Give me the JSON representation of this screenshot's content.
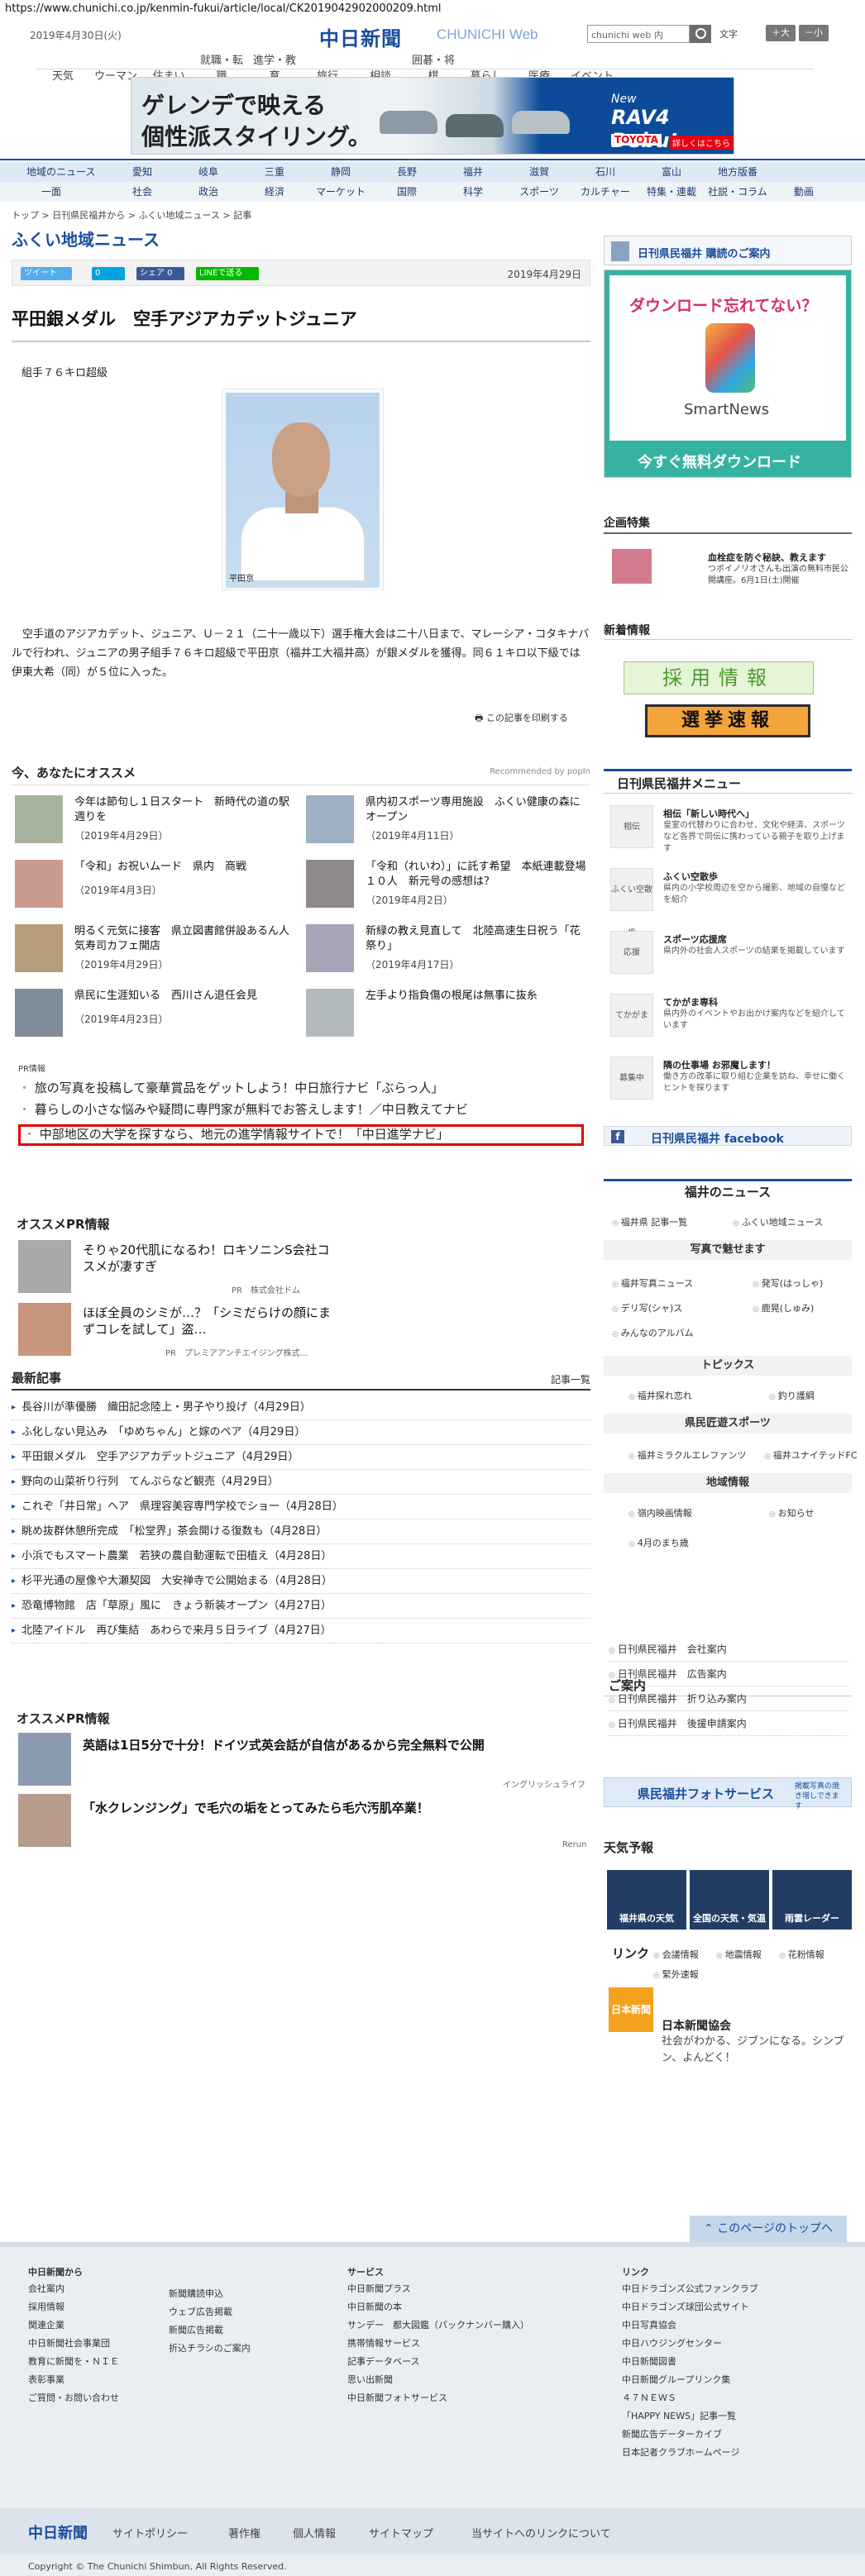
{
  "url": "https://www.chunichi.co.jp/kenmin-fukui/article/local/CK2019042902000209.html",
  "header": {
    "date": "2019年4月30日(火)",
    "logo": "中日新聞",
    "logo_web": "CHUNICHI Web",
    "search_placeholder": "chunichi web 内",
    "fontsize_label": "文字",
    "font_big": "＋大",
    "font_small": "－小"
  },
  "topnav": [
    "天気",
    "ウーマン",
    "住まい",
    "就職・転職",
    "進学・教育",
    "旅行",
    "相談",
    "囲碁・将棋",
    "暮らし",
    "医療",
    "イベント"
  ],
  "ad_banner": {
    "line1": "ゲレンデで映える",
    "line2": "個性派スタイリング。",
    "new": "New",
    "model": "RAV4 Debut",
    "brand": "TOYOTA",
    "detail": "詳しくはこちら"
  },
  "catnav_row1": [
    "地域のニュース",
    "愛知",
    "岐阜",
    "三重",
    "静岡",
    "長野",
    "福井",
    "滋賀",
    "石川",
    "富山",
    "地方版番"
  ],
  "catnav_row2": [
    "一面",
    "社会",
    "政治",
    "経済",
    "マーケット",
    "国際",
    "科学",
    "スポーツ",
    "カルチャー",
    "特集・連載",
    "社説・コラム",
    "動画"
  ],
  "breadcrumb": "トップ > 日刊県民福井から > ふくい地域ニュース > 記事",
  "section_title": "ふくい地域ニュース",
  "share": {
    "tweet": "ツイート",
    "b": "0",
    "share": "シェア 0",
    "line": "LINEで送る",
    "date": "2019年4月29日"
  },
  "article": {
    "headline": "平田銀メダル　空手アジアカデットジュニア",
    "caption_top": "組手７６キロ超級",
    "photo_caption": "平田京",
    "body": "空手道のアジアカデット、ジュニア、Ｕ－２１（二十一歳以下）選手権大会は二十八日まで、マレーシア・コタキナバルで行われ、ジュニアの男子組手７６キロ超級で平田京（福井工大福井高）が銀メダルを獲得。同６１キロ以下級では伊東大希（同）が５位に入った。",
    "print": "この記事を印刷する"
  },
  "reco": {
    "title": "今、あなたにオススメ",
    "right": "Recommended by popIn",
    "items": [
      {
        "title": "今年は節句し１日スタート　新時代の道の駅週りを",
        "date": "（2019年4月29日）"
      },
      {
        "title": "県内初スポーツ専用施設　ふくい健康の森にオープン",
        "date": "（2019年4月11日）"
      },
      {
        "title": "「令和」お祝いムード　県内　商戦",
        "date": "（2019年4月3日）"
      },
      {
        "title": "「令和（れいわ）」に託す希望　本紙連載登場１０人　新元号の感想は？",
        "date": "（2019年4月2日）"
      },
      {
        "title": "明るく元気に接客　県立図書館併設あるん人気寿司カフェ開店",
        "date": "（2019年4月29日）"
      },
      {
        "title": "新緑の教え見直して　北陸高速生日祝う「花祭り」",
        "date": "（2019年4月17日）"
      },
      {
        "title": "県民に生涯知いる　西川さん退任会見",
        "date": "（2019年4月23日）"
      },
      {
        "title": "左手より指負傷の根尾は無事に抜糸",
        "date": ""
      }
    ]
  },
  "pr": {
    "label": "PR情報",
    "lines": [
      "旅の写真を投稿して豪華賞品をゲットしよう！中日旅行ナビ「ぶらっ人」",
      "暮らしの小さな悩みや疑問に専門家が無料でお答えします！／中日教えてナビ",
      "中部地区の大学を探すなら、地元の進学情報サイトで！「中日進学ナビ」"
    ]
  },
  "oss_pr": {
    "title": "オススメPR情報",
    "items": [
      {
        "title": "そりゃ20代肌になるわ！ロキソニンS会社コスメが凄すぎ",
        "src": "PR　株式会社ドム"
      },
      {
        "title": "ほぼ全員のシミが…？「シミだらけの顔にまずコレを試して」盗…",
        "src": "PR　プレミアアンチエイジング株式…"
      }
    ]
  },
  "latest": {
    "title": "最新記事",
    "more": "記事一覧",
    "items": [
      "長谷川が準優勝　織田記念陸上・男子やり投げ（4月29日）",
      "ふ化しない見込み　「ゆめちゃん」と嫁のペア（4月29日）",
      "平田銀メダル　空手アジアカデットジュニア（4月29日）",
      "野向の山菜祈り行列　てんぷらなど観売（4月29日）",
      "これぞ「井日常」ヘア　県理容美容専門学校でショー（4月28日）",
      "眺め抜群休憩所完成　「松堂界」茶会開ける復数も（4月28日）",
      "小浜でもスマート農業　若狭の農自動運転で田植え（4月28日）",
      "杉平光通の屋像や大瀬契図　大安禅寺で公開始まる（4月28日）",
      "恐竜博物館　店「草原」風に　きょう新装オープン（4月27日）",
      "北陸アイドル　再び集結　あわらで来月５日ライブ（4月27日）"
    ]
  },
  "oss_pr2": {
    "title": "オススメPR情報",
    "items": [
      {
        "title": "英語は1日5分で十分！ドイツ式英会話が自信があるから完全無料で公開",
        "src": "イングリッシュライフ"
      },
      {
        "title": "「水クレンジング」で毛穴の垢をとってみたら毛穴汚肌卒業！",
        "src": "Rerun"
      }
    ]
  },
  "sidebar": {
    "subscribe": "日刊県民福井 購読のご案内",
    "ad": {
      "t1": "ダウンロード忘れてない？",
      "t2": "SmartNews",
      "t3": "今すぐ無料ダウンロード"
    },
    "kikaku_title": "企画特集",
    "kikaku_item": {
      "title": "血栓症を防ぐ秘訣、教えます",
      "desc": "つボイノリオさんも出演の無料市民公開講座。6月1日(土)開催"
    },
    "news_title": "新着情報",
    "banner1": "採用情報",
    "banner2": "選挙速報",
    "menu_title": "日刊県民福井メニュー",
    "menu": [
      {
        "icon": "相伝",
        "title": "相伝「新しい時代へ」",
        "desc": "皇室の代替わりに合わせ、文化や経済、スポーツなど各界で同伝に携わっている親子を取り上げます"
      },
      {
        "icon": "ふくい空散歩",
        "title": "ふくい空散歩",
        "desc": "県内の小学校周辺を空から撮影、地域の自慢などを紹介"
      },
      {
        "icon": "応援",
        "title": "スポーツ応援席",
        "desc": "県内外の社会人スポーツの結果を掲載しています"
      },
      {
        "icon": "てかがま",
        "title": "てかがま専科",
        "desc": "県内外のイベントやお出かけ案内などを紹介しています"
      },
      {
        "icon": "募集中",
        "title": "隣の仕事場 お邪魔します！",
        "desc": "働き方の改革に取り組む企業を訪ね、幸せに働くヒントを探ります"
      }
    ],
    "facebook": "日刊県民福井 facebook",
    "fukui_news": "福井のニュース",
    "fukui_links": [
      "福井県 記事一覧",
      "ふくい地域ニュース"
    ],
    "photo_title": "写真で魅せます",
    "photo_links": [
      "福井写真ニュース",
      "発写(はっしゃ)",
      "デリ写(シャ)ス",
      "鹿晃(しゅみ)",
      "みんなのアルバム"
    ],
    "topics_title": "トピックス",
    "topics_links": [
      "福井探れ恋れ",
      "釣り護綱"
    ],
    "sports_title": "県民匠遊スポーツ",
    "sports_links": [
      "福井ミラクルエレファンツ",
      "福井ユナイテッドFC"
    ],
    "region_title": "地域情報",
    "region_links": [
      "嶺内映画情報",
      "お知らせ",
      "4月のまち歳"
    ],
    "goannai_title": "ご案内",
    "goannai": [
      "日刊県民福井　会社案内",
      "日刊県民福井　広告案内",
      "日刊県民福井　折り込み案内",
      "日刊県民福井　後援申請案内"
    ],
    "photo_service": "県民福井フォトサービス",
    "photo_service_sub": "掲載写真の焼き増しできます",
    "weather_title": "天気予報",
    "weather": [
      "福井県の天気",
      "全国の天気・気温",
      "雨雲レーダー"
    ],
    "link_title": "リンク",
    "link_items": [
      "会議情報",
      "地震情報",
      "花粉情報",
      "緊外速報"
    ],
    "nbook_icon": "日本新聞",
    "nbook_title": "日本新聞協会",
    "nbook_desc": "社会がわかる、ジブンになる。シンブン、よんどく！"
  },
  "pagetop": "このページのトップへ",
  "footer": {
    "col1_title": "中日新聞から",
    "col1": [
      "会社案内",
      "採用情報",
      "関連企業",
      "中日新聞社会事業団",
      "教育に新聞を・ＮＩＥ",
      "表彰事業",
      "ご質問・お問い合わせ"
    ],
    "col1b": [
      "新聞購読申込",
      "ウェブ広告掲載",
      "新聞広告掲載",
      "折込チラシのご案内"
    ],
    "col2_title": "サービス",
    "col2": [
      "中日新聞プラス",
      "中日新聞の本",
      "サンデー　都大図鑑（パックナンバー購入）",
      "携帯情報サービス",
      "記事データベース",
      "思い出新聞",
      "中日新聞フォトサービス"
    ],
    "col3_title": "リンク",
    "col3": [
      "中日ドラゴンズ公式ファンクラブ",
      "中日ドラゴンズ球団公式サイト",
      "中日写真協会",
      "中日ハウジングセンター",
      "中日新聞図書",
      "中日新聞グループリンク集",
      "４７ＮＥＷＳ",
      "「HAPPY NEWS」記事一覧",
      "新聞広告データーカイブ",
      "日本記者クラブホームページ"
    ],
    "nav_logo": "中日新聞",
    "nav": [
      "サイトポリシー",
      "著作権",
      "個人情報",
      "サイトマップ",
      "当サイトへのリンクについて"
    ],
    "copyright": "Copyright © The Chunichi Shimbun, All Rights Reserved."
  }
}
